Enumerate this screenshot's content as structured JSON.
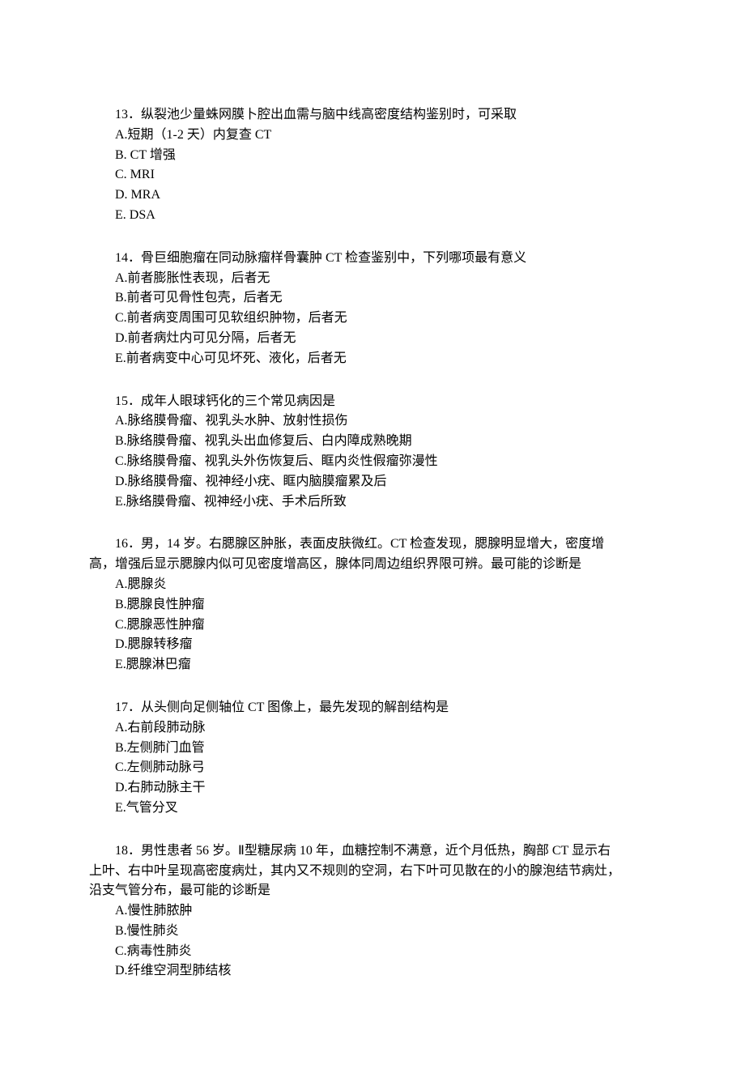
{
  "questions": [
    {
      "num": "13",
      "stem": "．纵裂池少量蛛网膜卜腔出血需与脑中线高密度结构鉴别时，可采取",
      "opts": [
        "A.短期（1-2 天）内复查 CT",
        "B.   CT 增强",
        "C.   MRI",
        "D.   MRA",
        "E.   DSA"
      ]
    },
    {
      "num": "14",
      "stem": "．骨巨细胞瘤在同动脉瘤样骨囊肿 CT 检查鉴别中，下列哪项最有意义",
      "opts": [
        "A.前者膨胀性表现，后者无",
        "B.前者可见骨性包壳，后者无",
        "C.前者病变周围可见软组织肿物，后者无",
        "D.前者病灶内可见分隔，后者无",
        "E.前者病变中心可见坏死、液化，后者无"
      ]
    },
    {
      "num": "15",
      "stem": "．成年人眼球钙化的三个常见病因是",
      "opts": [
        "A.脉络膜骨瘤、视乳头水肿、放射性损伤",
        "B.脉络膜骨瘤、视乳头出血修复后、白内障成熟晚期",
        "C.脉络膜骨瘤、视乳头外伤恢复后、眶内炎性假瘤弥漫性",
        "D.脉络膜骨瘤、视神经小疣、眶内脑膜瘤累及后",
        "E.脉络膜骨瘤、视神经小疣、手术后所致"
      ]
    },
    {
      "num": "16",
      "stem": "．男，14 岁。右腮腺区肿胀，表面皮肤微红。CT 检查发现，腮腺明显增大，密度增",
      "stem_cont": "高，增强后显示腮腺内似可见密度增高区，腺体同周边组织界限可辨。最可能的诊断是",
      "opts": [
        "A.腮腺炎",
        "B.腮腺良性肿瘤",
        "C.腮腺恶性肿瘤",
        "D.腮腺转移瘤",
        "E.腮腺淋巴瘤"
      ]
    },
    {
      "num": "17",
      "stem": "．从头侧向足侧轴位 CT 图像上，最先发现的解剖结构是",
      "opts": [
        "A.右前段肺动脉",
        "B.左侧肺门血管",
        "C.左侧肺动脉弓",
        "D.右肺动脉主干",
        "E.气管分叉"
      ]
    },
    {
      "num": "18",
      "stem": "．男性患者 56 岁。Ⅱ型糖尿病 10 年，血糖控制不满意，近个月低热，胸部 CT 显示右",
      "stem_cont": "上叶、右中叶呈现高密度病灶，其内又不规则的空洞，右下叶可见散在的小的腺泡结节病灶，",
      "stem_cont2": "沿支气管分布，最可能的诊断是",
      "opts": [
        "A.慢性肺脓肿",
        "B.慢性肺炎",
        "C.病毒性肺炎",
        "D.纤维空洞型肺结核"
      ]
    }
  ]
}
